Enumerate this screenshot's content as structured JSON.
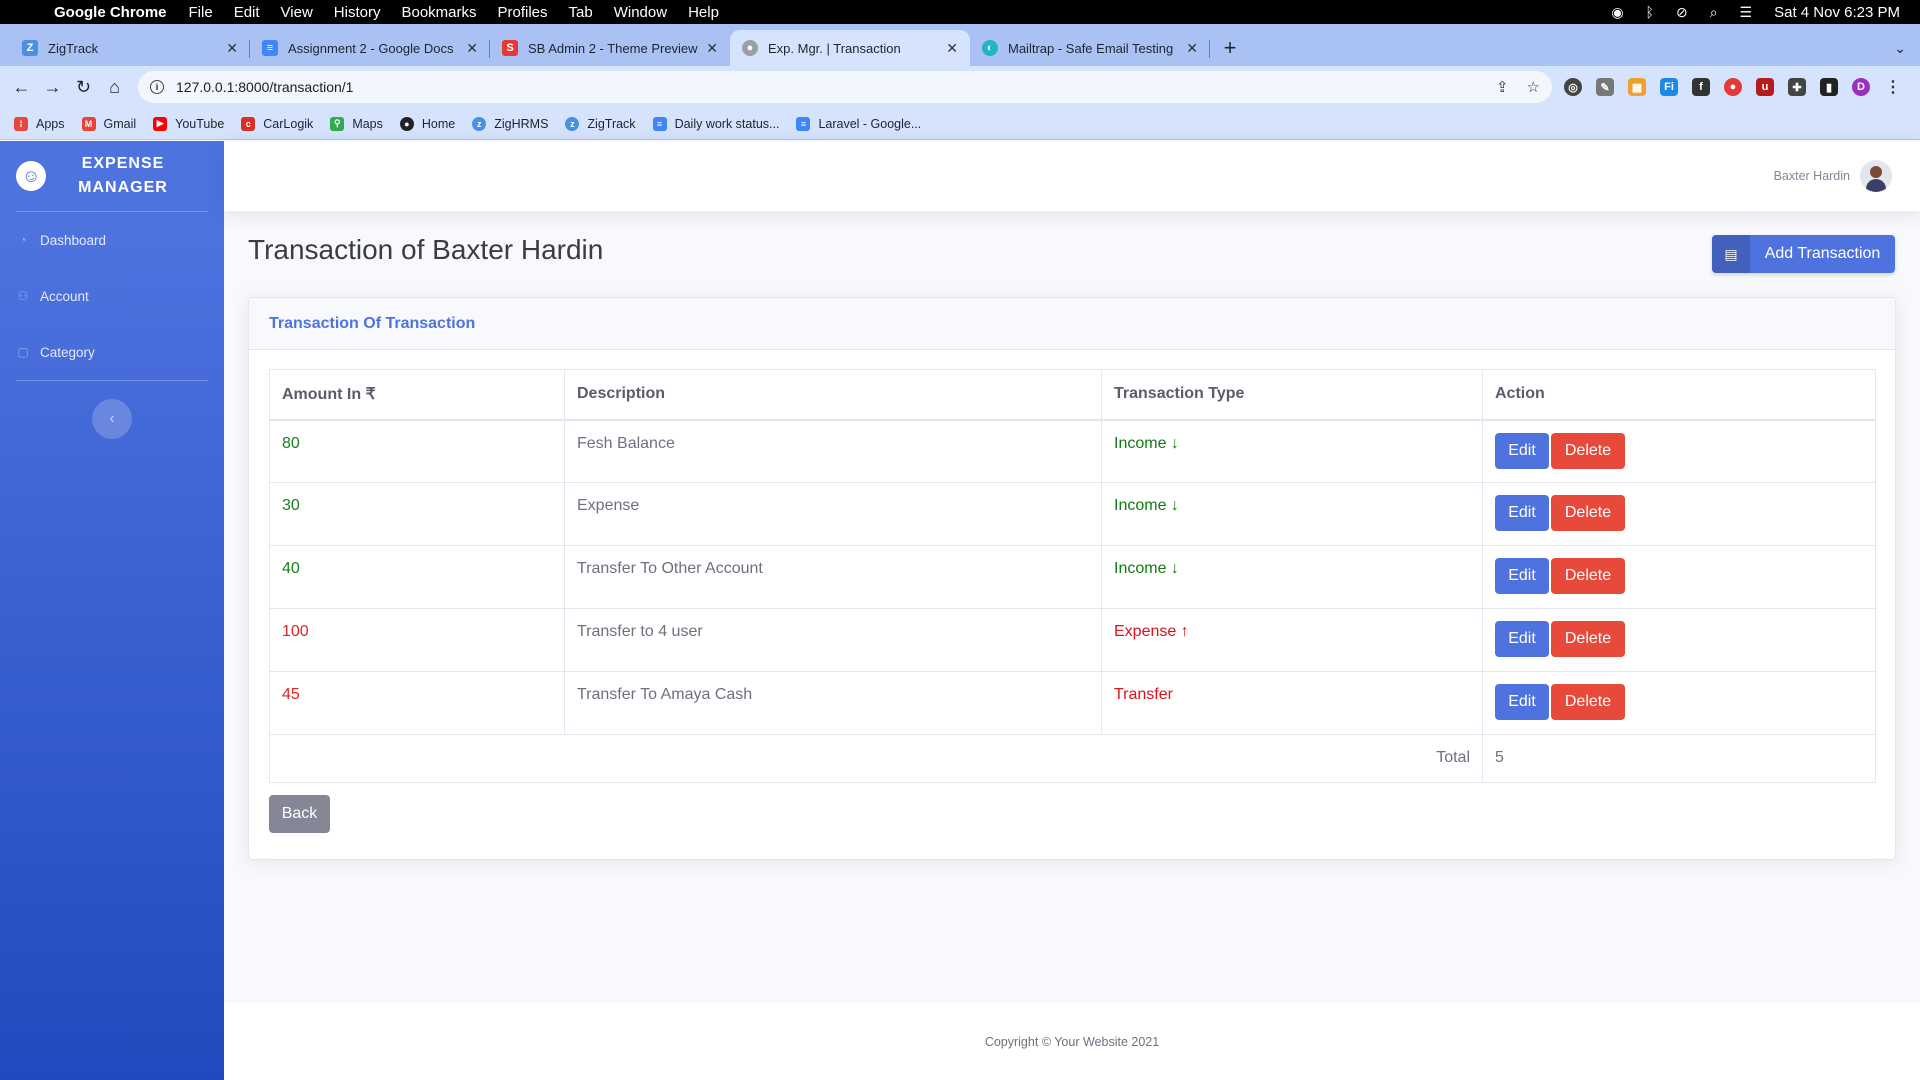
{
  "menubar": {
    "app": "Google Chrome",
    "items": [
      "File",
      "Edit",
      "View",
      "History",
      "Bookmarks",
      "Profiles",
      "Tab",
      "Window",
      "Help"
    ],
    "datetime": "Sat 4 Nov  6:23 PM"
  },
  "tabs": [
    {
      "label": "ZigTrack",
      "favicon_color": "#4a90e2"
    },
    {
      "label": "Assignment 2 - Google Docs",
      "favicon_color": "#4285f4"
    },
    {
      "label": "SB Admin 2 - Theme Preview",
      "favicon_color": "#e53935"
    },
    {
      "label": "Exp. Mgr. | Transaction",
      "favicon_color": "#9aa0a6"
    },
    {
      "label": "Mailtrap - Safe Email Testing",
      "favicon_color": "#22b5bf"
    }
  ],
  "browser": {
    "url": "127.0.0.1:8000/transaction/1",
    "profile_initial": "D"
  },
  "bookmarks": [
    {
      "label": "Apps",
      "color": "#e8453c"
    },
    {
      "label": "Gmail",
      "color": "#ea4335"
    },
    {
      "label": "YouTube",
      "color": "#ff0000"
    },
    {
      "label": "CarLogik",
      "color": "#d93025"
    },
    {
      "label": "Maps",
      "color": "#34a853"
    },
    {
      "label": "Home",
      "color": "#222222"
    },
    {
      "label": "ZigHRMS",
      "color": "#4a90e2"
    },
    {
      "label": "ZigTrack",
      "color": "#4a90e2"
    },
    {
      "label": "Daily work status...",
      "color": "#4285f4"
    },
    {
      "label": "Laravel - Google...",
      "color": "#4285f4"
    }
  ],
  "sidebar": {
    "brand": "Expense Manager",
    "items": [
      {
        "label": "Dashboard",
        "icon": "tachometer-icon"
      },
      {
        "label": "Account",
        "icon": "users-icon"
      },
      {
        "label": "Category",
        "icon": "square-icon"
      }
    ]
  },
  "topbar": {
    "user_name": "Baxter Hardin"
  },
  "page": {
    "title": "Transaction of Baxter Hardin",
    "add_button": "Add Transaction",
    "card_title": "Transaction Of Transaction",
    "back_button": "Back"
  },
  "table": {
    "headers": [
      "Amount In ₹",
      "Description",
      "Transaction Type",
      "Action"
    ],
    "rows": [
      {
        "amount": "80",
        "description": "Fesh Balance",
        "type": "Income",
        "arrow": "↓",
        "kind": "inc"
      },
      {
        "amount": "30",
        "description": "Expense",
        "type": "Income",
        "arrow": "↓",
        "kind": "inc"
      },
      {
        "amount": "40",
        "description": "Transfer To Other Account",
        "type": "Income",
        "arrow": "↓",
        "kind": "inc"
      },
      {
        "amount": "100",
        "description": "Transfer to 4 user",
        "type": "Expense",
        "arrow": "↑",
        "kind": "exp"
      },
      {
        "amount": "45",
        "description": "Transfer To Amaya Cash",
        "type": "Transfer",
        "arrow": "",
        "kind": "exp"
      }
    ],
    "edit_label": "Edit",
    "delete_label": "Delete",
    "total_label": "Total",
    "total_value": "5"
  },
  "footer": {
    "text": "Copyright © Your Website 2021"
  },
  "colors": {
    "primary": "#4e73df",
    "danger": "#e74a3b",
    "secondary": "#858796",
    "income": "#137a13",
    "expense": "#e0101a"
  }
}
